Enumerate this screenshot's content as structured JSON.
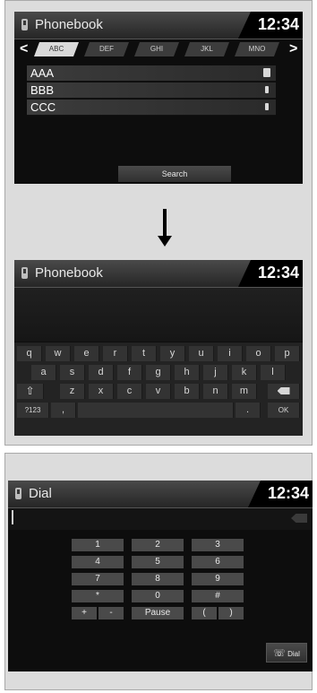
{
  "screen1": {
    "title": "Phonebook",
    "time": "12:34",
    "nav_left": "<",
    "nav_right": ">",
    "tabs": [
      "ABC",
      "DEF",
      "GHI",
      "JKL",
      "MNO"
    ],
    "active_tab": "ABC",
    "contacts": [
      {
        "name": "AAA",
        "icon": "multi-phone-icon"
      },
      {
        "name": "BBB",
        "icon": "phone-icon"
      },
      {
        "name": "CCC",
        "icon": "phone-icon"
      }
    ],
    "search_label": "Search"
  },
  "screen2": {
    "title": "Phonebook",
    "time": "12:34",
    "row1": [
      "q",
      "w",
      "e",
      "r",
      "t",
      "y",
      "u",
      "i",
      "o",
      "p"
    ],
    "row2": [
      "a",
      "s",
      "d",
      "f",
      "g",
      "h",
      "j",
      "k",
      "l"
    ],
    "row3": [
      "z",
      "x",
      "c",
      "v",
      "b",
      "n",
      "m"
    ],
    "symbols_label": "?123",
    "comma_label": ",",
    "period_label": ".",
    "ok_label": "OK"
  },
  "screen3": {
    "title": "Dial",
    "time": "12:34",
    "keys": [
      [
        "1",
        "2",
        "3"
      ],
      [
        "4",
        "5",
        "6"
      ],
      [
        "7",
        "8",
        "9"
      ],
      [
        "*",
        "0",
        "#"
      ]
    ],
    "bottom_row": [
      "+",
      "-",
      "Pause",
      "(",
      ")"
    ],
    "dial_label": "Dial"
  }
}
